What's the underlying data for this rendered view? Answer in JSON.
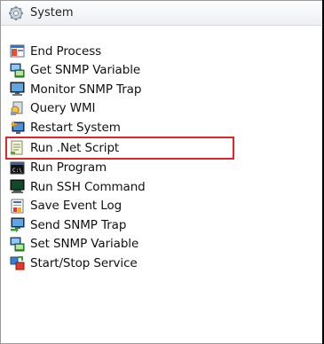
{
  "panel": {
    "title": "System",
    "title_icon": "gear-icon"
  },
  "items": [
    {
      "label": "End Process",
      "icon": "end-process-icon"
    },
    {
      "label": "Get SNMP Variable",
      "icon": "get-snmp-variable-icon"
    },
    {
      "label": "Monitor SNMP Trap",
      "icon": "monitor-snmp-trap-icon"
    },
    {
      "label": "Query WMI",
      "icon": "query-wmi-icon"
    },
    {
      "label": "Restart System",
      "icon": "restart-system-icon"
    },
    {
      "label": "Run .Net Script",
      "icon": "run-net-script-icon",
      "highlighted": true
    },
    {
      "label": "Run Program",
      "icon": "run-program-icon"
    },
    {
      "label": "Run SSH Command",
      "icon": "run-ssh-command-icon"
    },
    {
      "label": "Save Event Log",
      "icon": "save-event-log-icon"
    },
    {
      "label": "Send SNMP Trap",
      "icon": "send-snmp-trap-icon"
    },
    {
      "label": "Set SNMP Variable",
      "icon": "set-snmp-variable-icon"
    },
    {
      "label": "Start/Stop Service",
      "icon": "start-stop-service-icon"
    }
  ],
  "colors": {
    "highlight_border": "#e0262b"
  }
}
